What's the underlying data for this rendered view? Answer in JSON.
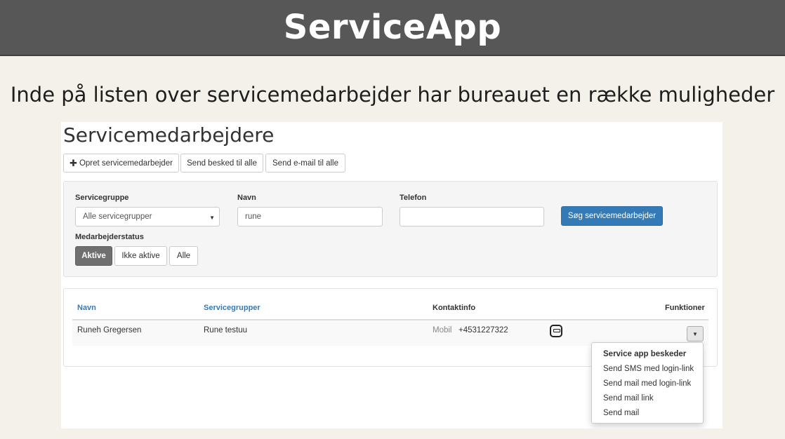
{
  "slide": {
    "title": "ServiceApp",
    "subtitle": "Inde på listen over servicemedarbejder har bureauet en række muligheder"
  },
  "page": {
    "title": "Servicemedarbejdere"
  },
  "toolbar": {
    "create_label": "Opret servicemedarbejder",
    "send_message_label": "Send besked til alle",
    "send_email_label": "Send e-mail til alle"
  },
  "filters": {
    "servicegroup_label": "Servicegruppe",
    "servicegroup_value": "Alle servicegrupper",
    "name_label": "Navn",
    "name_value": "rune",
    "phone_label": "Telefon",
    "phone_value": "",
    "search_button": "Søg servicemedarbejder",
    "status_label": "Medarbejderstatus",
    "status_options": [
      "Aktive",
      "Ikke aktive",
      "Alle"
    ],
    "status_selected": "Aktive"
  },
  "table": {
    "columns": [
      "Navn",
      "Servicegrupper",
      "Kontaktinfo",
      "Funktioner"
    ],
    "rows": [
      {
        "name": "Runeh Gregersen",
        "group": "Rune testuu",
        "contact_type": "Mobil",
        "contact_value": "+4531227322"
      }
    ]
  },
  "functions_menu": {
    "header": "Service app beskeder",
    "items": [
      "Send SMS med login-link",
      "Send mail med login-link",
      "Send mail link",
      "Send mail"
    ]
  },
  "colors": {
    "header_bg": "#575757",
    "slide_bg": "#f4f1ea",
    "primary": "#337ab7",
    "active_segment": "#6f6f6f"
  }
}
